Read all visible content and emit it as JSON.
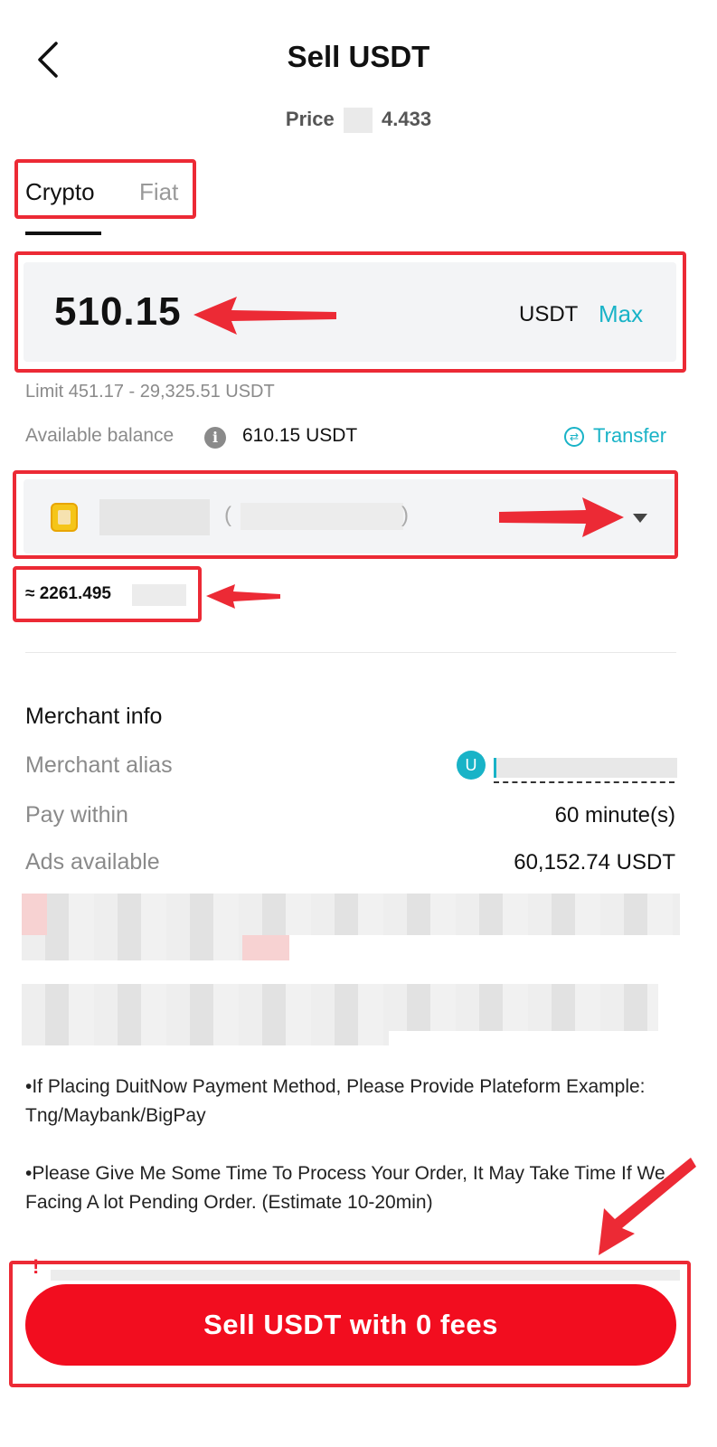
{
  "header": {
    "title": "Sell USDT",
    "price_label": "Price",
    "price_value": "4.433"
  },
  "tabs": [
    {
      "label": "Crypto",
      "active": true
    },
    {
      "label": "Fiat",
      "active": false
    }
  ],
  "amount": {
    "value": "510.15",
    "unit": "USDT",
    "max_label": "Max"
  },
  "limit_text": "Limit 451.17 - 29,325.51 USDT",
  "balance": {
    "label": "Available balance",
    "value": "610.15 USDT",
    "transfer_label": "Transfer"
  },
  "payment_method": {
    "open_paren": "(",
    "close_paren": ")"
  },
  "approx_fiat": "≈ 2261.495",
  "merchant": {
    "section_title": "Merchant info",
    "rows": [
      {
        "label": "Merchant alias",
        "value": ""
      },
      {
        "label": "Pay within",
        "value": "60 minute(s)"
      },
      {
        "label": "Ads available",
        "value": "60,152.74 USDT"
      }
    ],
    "avatar_letter": "U"
  },
  "remarks": [
    "•If Placing DuitNow Payment Method, Please Provide Plateform Example: Tng/Maybank/BigPay",
    "•Please Give Me Some Time To Process Your Order, It May Take Time If We Facing A lot Pending Order. (Estimate 10-20min)"
  ],
  "warning_mark": "!",
  "sell_button_label": "Sell USDT with 0 fees",
  "colors": {
    "accent": "#19b3c7",
    "primary_button": "#f20d1f",
    "annotation": "#ec2a35"
  },
  "icons": [
    "back-arrow-icon",
    "info-icon",
    "transfer-icon",
    "payment-method-icon",
    "dropdown-caret-icon",
    "merchant-avatar"
  ]
}
